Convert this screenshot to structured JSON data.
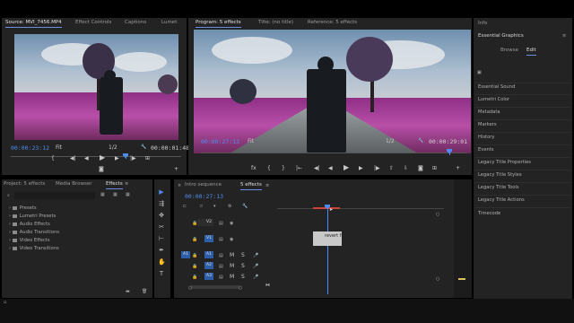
{
  "source": {
    "tabs": [
      "Source: MVI_7456.MP4",
      "Effect Controls",
      "Captions",
      "Lumet"
    ],
    "timecode_in": "00:00:23:12",
    "fit": "Fit",
    "resolution": "1/2",
    "timecode_dur": "00:00:01:48"
  },
  "program": {
    "tabs": [
      "Program: 5 effects",
      "Title: (no title)",
      "Reference: 5 effects"
    ],
    "timecode": "00:00:27:13",
    "fit": "Fit",
    "resolution": "1/2",
    "timecode_dur": "00:00:29:01"
  },
  "right_panel": {
    "info": "Info",
    "title": "Essential Graphics",
    "browse": "Browse",
    "edit": "Edit",
    "items": [
      "Essential Sound",
      "Lumetri Color",
      "Metadata",
      "Markers",
      "History",
      "Events",
      "Legacy Title Properties",
      "Legacy Title Styles",
      "Legacy Title Tools",
      "Legacy Title Actions",
      "Timecode"
    ]
  },
  "project": {
    "tabs": [
      "Project: 5 effects",
      "Media Browser",
      "Effects"
    ],
    "items": [
      "Presets",
      "Lumetri Presets",
      "Audio Effects",
      "Audio Transitions",
      "Video Effects",
      "Video Transitions"
    ]
  },
  "timeline": {
    "tabs": [
      "Intro sequence",
      "5 effects"
    ],
    "timecode": "00:00:27:13",
    "tracks": {
      "v2": "V2",
      "v1": "V1",
      "a1_src": "A1",
      "a1": "A1",
      "a2": "A2",
      "a3": "A3",
      "m": "M",
      "s": "S",
      "o": "O"
    },
    "clip_label": "revert fx"
  },
  "colors": {
    "accent": "#4f8cf0",
    "track_blue": "#2d5fa8",
    "panel": "#232323"
  }
}
